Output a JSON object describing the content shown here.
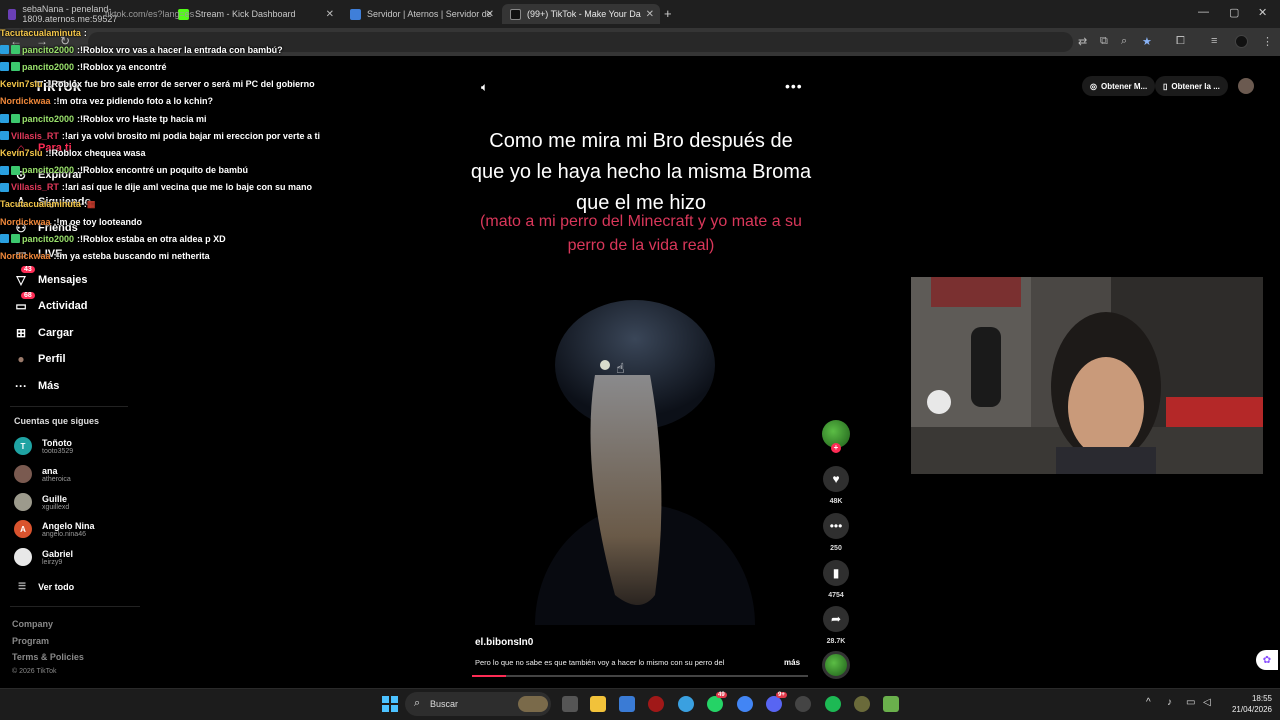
{
  "browser": {
    "tabs": [
      {
        "label": "sebaNana - peneland-1809.aternos.me:59527",
        "overlay_prefix": "Tacutacual"
      },
      {
        "label": "Stream - Kick Dashboard"
      },
      {
        "label": "Servidor | Aternos | Servidor de"
      },
      {
        "label": "(99+) TikTok - Make Your Da"
      }
    ],
    "url": "tiktok.com/es?lang=es",
    "window_controls": {
      "minimize": "—",
      "maximize": "▢",
      "close": "✕"
    }
  },
  "chat": [
    {
      "user": "Tacutacualaminuta",
      "sep": " : ",
      "msg": "",
      "color": "#f3c64a",
      "badges": []
    },
    {
      "user": "pancito2000",
      "sep": " : ",
      "msg": "!Roblox vro vas a hacer la entrada con bambú?",
      "color": "#9be36d",
      "badges": [
        "b",
        "g"
      ]
    },
    {
      "user": "pancito2000",
      "sep": " : ",
      "msg": "!Roblox ya encontré",
      "color": "#9be36d",
      "badges": [
        "b",
        "g"
      ]
    },
    {
      "user": "Kevin7sIu",
      "sep": " : ",
      "msg": "!Roblox fue bro sale error de server o será mi PC del gobierno",
      "color": "#f3c64a",
      "badges": []
    },
    {
      "user": "Nordickwaa",
      "sep": " : ",
      "msg": "!m otra vez pidiendo foto a lo kchin?",
      "color": "#f0883a",
      "badges": []
    },
    {
      "user": "pancito2000",
      "sep": " : ",
      "msg": "!Roblox vro Haste tp hacia mi",
      "color": "#9be36d",
      "badges": [
        "b",
        "g"
      ]
    },
    {
      "user": "Villasis_RT",
      "sep": " : ",
      "msg": "!ari ya volvi brosito mi podia bajar mi ereccion por verte a ti",
      "color": "#e0385a",
      "badges": [
        "b"
      ]
    },
    {
      "user": "Kevin7sIu",
      "sep": " : ",
      "msg": "!Roblox chequea wasa",
      "color": "#f3c64a",
      "badges": []
    },
    {
      "user": "pancito2000",
      "sep": " : ",
      "msg": "!Roblox encontré un poquito de bambú",
      "color": "#9be36d",
      "badges": [
        "b",
        "g"
      ]
    },
    {
      "user": "Villasis_RT",
      "sep": " : ",
      "msg": "!ari así que le dije aml vecina que me lo baje con su mano",
      "color": "#e0385a",
      "badges": [
        "b"
      ]
    },
    {
      "user": "Tacutacualaminuta",
      "sep": " : ",
      "msg": "▦",
      "color": "#f3c64a",
      "badges": []
    },
    {
      "user": "Nordickwaa",
      "sep": " : ",
      "msg": "!m oe toy looteando",
      "color": "#f0883a",
      "badges": []
    },
    {
      "user": "pancito2000",
      "sep": " : ",
      "msg": "!Roblox estaba en otra aldea p XD",
      "color": "#9be36d",
      "badges": [
        "b",
        "g"
      ]
    },
    {
      "user": "Nordickwaa",
      "sep": " : ",
      "msg": "!m ya esteba buscando mi netherita",
      "color": "#f0883a",
      "badges": []
    }
  ],
  "sidebar": {
    "logo": "TikTok",
    "menu": [
      {
        "label": "Para ti",
        "icon": "home-icon",
        "glyph": "⌂"
      },
      {
        "label": "Explorar",
        "icon": "compass-icon",
        "glyph": "⊙"
      },
      {
        "label": "Siguiendo",
        "icon": "following-icon",
        "glyph": "♙"
      },
      {
        "label": "Friends",
        "icon": "friends-icon",
        "glyph": "⚇"
      },
      {
        "label": "LIVE",
        "icon": "live-icon",
        "glyph": "▭"
      },
      {
        "label": "Mensajes",
        "icon": "inbox-icon",
        "glyph": "▽",
        "badge": "43"
      },
      {
        "label": "Actividad",
        "icon": "activity-icon",
        "glyph": "▭",
        "badge": "68"
      },
      {
        "label": "Cargar",
        "icon": "upload-icon",
        "glyph": "⊞"
      },
      {
        "label": "Perfil",
        "icon": "profile-icon",
        "glyph": "●"
      },
      {
        "label": "Más",
        "icon": "more-icon",
        "glyph": "···"
      }
    ],
    "following_title": "Cuentas que sigues",
    "following": [
      {
        "name": "Toñoto",
        "handle": "tooto3529",
        "initial": "T",
        "color": "#1fa3a3"
      },
      {
        "name": "ana",
        "handle": "atheroica",
        "initial": "",
        "color": "#7a5a50"
      },
      {
        "name": "Guille",
        "handle": "xguillexd",
        "initial": "",
        "color": "#9c9a8c"
      },
      {
        "name": "Angelo Nina",
        "handle": "angelo.nina46",
        "initial": "A",
        "color": "#d9532e"
      },
      {
        "name": "Gabriel",
        "handle": "leirzy9",
        "initial": "",
        "color": "#e8e8e8"
      }
    ],
    "see_all": "Ver todo",
    "footer": [
      "Company",
      "Program",
      "Terms & Policies"
    ],
    "copyright": "© 2026 TikTok"
  },
  "video": {
    "caption": "Como me mira mi Bro después de que yo le haya hecho la misma Broma que el me hizo",
    "subcaption": "(mato a mi perro del Minecraft y yo mate a su perro de la vida real)",
    "author": "el.bibonsIn0",
    "description": "Pero lo que no sabe es que también voy a hacer lo mismo con su perro del",
    "more_label": "más",
    "progress": 0.1,
    "actions": {
      "likes": "48K",
      "comments": "250",
      "saves": "4754",
      "shares": "28.7K"
    }
  },
  "top_right": {
    "btn1": "Obtener M...",
    "btn2": "Obtener la ..."
  },
  "taskbar": {
    "search_label": "Buscar",
    "time": "18:55",
    "date": "21/04/2026",
    "whatsapp_badge": "49",
    "discord_badge": "9+"
  }
}
